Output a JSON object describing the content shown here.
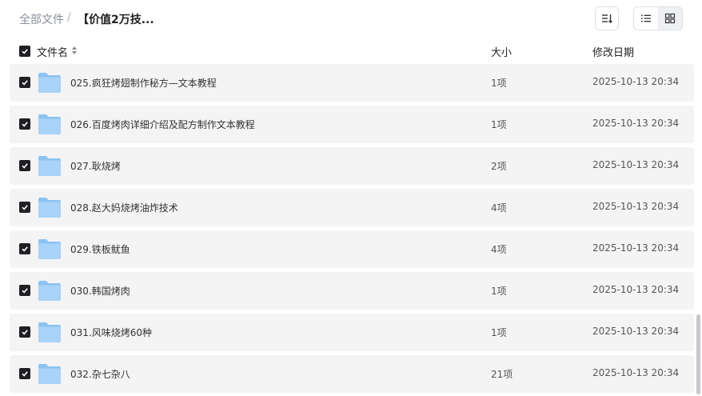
{
  "breadcrumb": {
    "root": "全部文件",
    "separator": "/",
    "current": "【价值2万技..."
  },
  "toolbar": {
    "sort_icon": "sort-list-icon",
    "list_view_icon": "list-view-icon",
    "grid_view_icon": "grid-view-icon"
  },
  "columns": {
    "name": "文件名",
    "size": "大小",
    "date": "修改日期"
  },
  "files": [
    {
      "name": "025.疯狂烤翅制作秘方—文本教程",
      "size": "1项",
      "date": "2025-10-13 20:34",
      "checked": true
    },
    {
      "name": "026.百度烤肉详细介绍及配方制作文本教程",
      "size": "1项",
      "date": "2025-10-13 20:34",
      "checked": true
    },
    {
      "name": "027.耿烧烤",
      "size": "2项",
      "date": "2025-10-13 20:34",
      "checked": true
    },
    {
      "name": "028.赵大妈烧烤油炸技术",
      "size": "4项",
      "date": "2025-10-13 20:34",
      "checked": true
    },
    {
      "name": "029.铁板鱿鱼",
      "size": "4项",
      "date": "2025-10-13 20:34",
      "checked": true
    },
    {
      "name": "030.韩国烤肉",
      "size": "1项",
      "date": "2025-10-13 20:34",
      "checked": true
    },
    {
      "name": "031.风味烧烤60种",
      "size": "1项",
      "date": "2025-10-13 20:34",
      "checked": true
    },
    {
      "name": "032.杂七杂八",
      "size": "21项",
      "date": "2025-10-13 20:34",
      "checked": true
    }
  ],
  "colors": {
    "row_bg": "#f4f4f5",
    "checkbox": "#1f1f24",
    "folder_back": "#8cc3f2",
    "folder_front": "#a9d3f8"
  }
}
